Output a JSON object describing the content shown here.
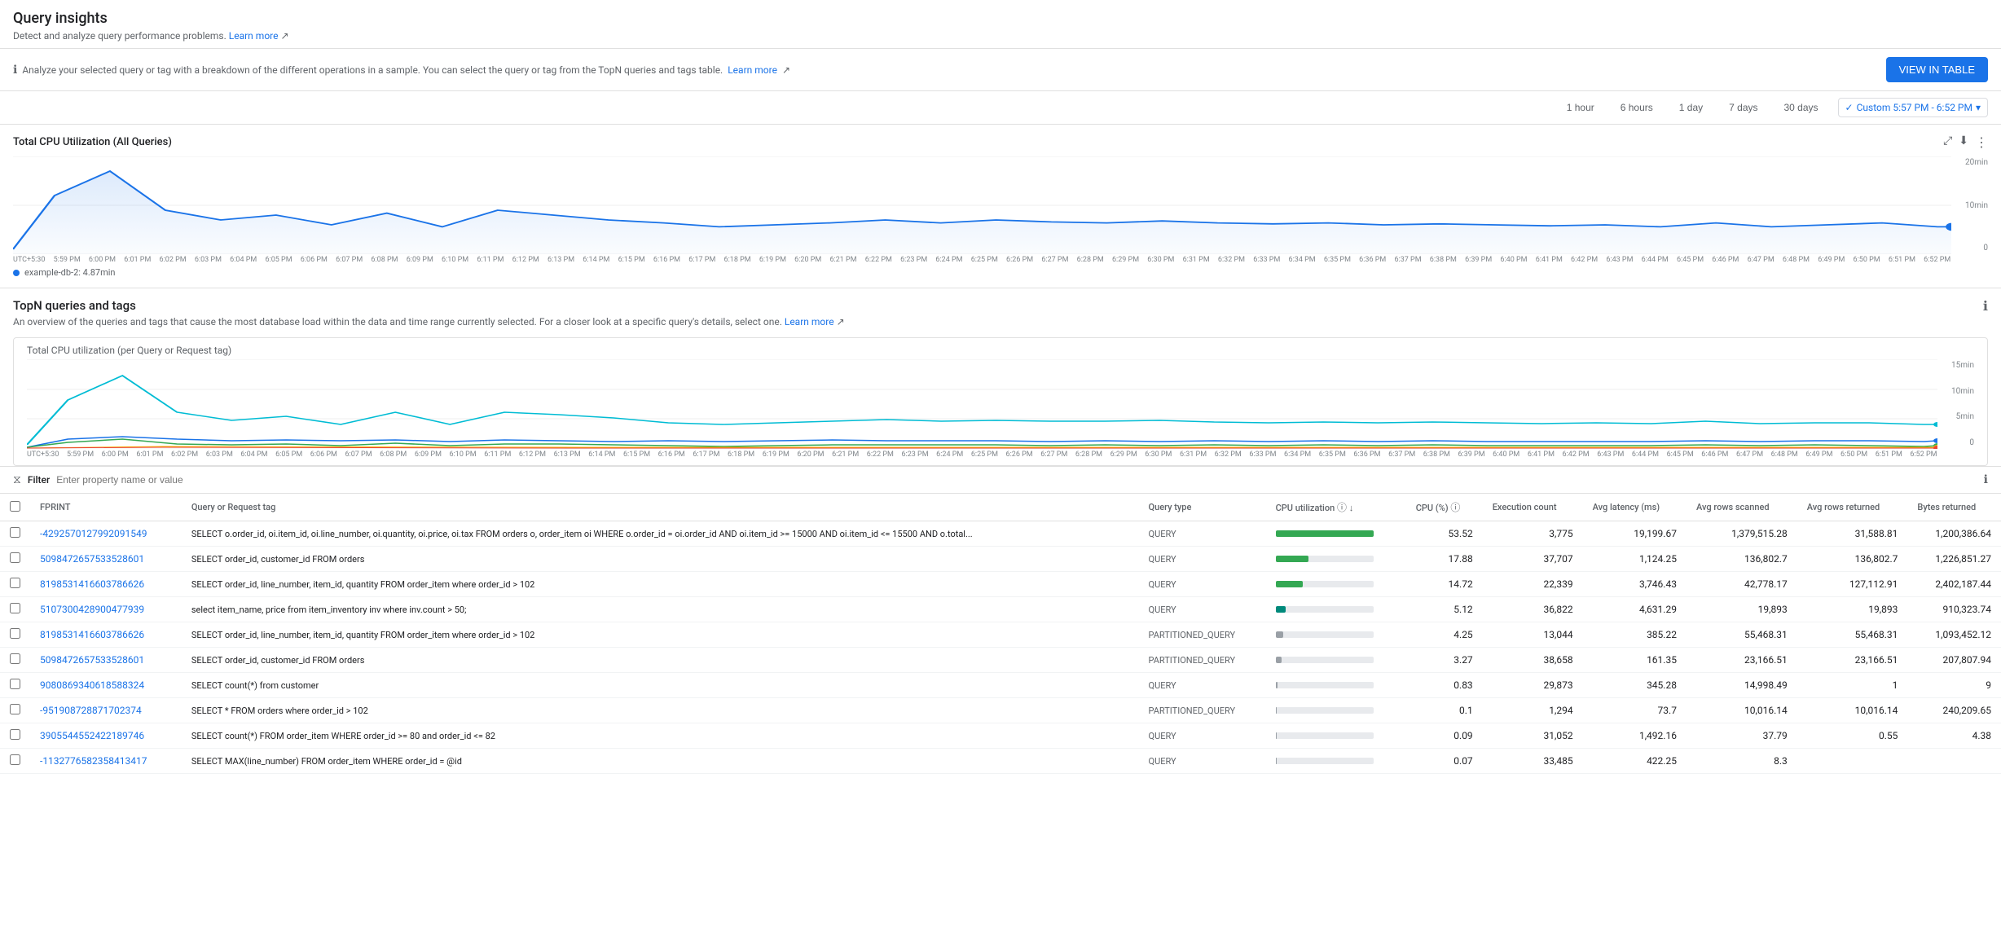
{
  "page": {
    "title": "Query insights",
    "subtitle": "Detect and analyze query performance problems.",
    "subtitle_link": "Learn more",
    "info_banner": "Analyze your selected query or tag with a breakdown of the different operations in a sample. You can select the query or tag from the TopN queries and tags table.",
    "info_banner_link": "Learn more",
    "view_table_btn": "VIEW IN TABLE"
  },
  "time_range": {
    "options": [
      "1 hour",
      "6 hours",
      "1 day",
      "7 days",
      "30 days"
    ],
    "custom_label": "Custom 5:57 PM - 6:52 PM",
    "active": "custom"
  },
  "total_cpu_chart": {
    "title": "Total CPU Utilization (All Queries)",
    "y_labels": [
      "20min",
      "10min",
      "0"
    ],
    "legend": "example-db-2: 4.87min",
    "legend_color": "#1a73e8"
  },
  "topn": {
    "title": "TopN queries and tags",
    "description": "An overview of the queries and tags that cause the most database load within the data and time range currently selected. For a closer look at a specific query's details, select one.",
    "description_link": "Learn more",
    "cpu_chart_title": "Total CPU utilization (per Query or Request tag)",
    "cpu_y_labels": [
      "15min",
      "10min",
      "5min",
      "0"
    ]
  },
  "filter": {
    "label": "Filter",
    "placeholder": "Enter property name or value"
  },
  "table": {
    "columns": [
      {
        "id": "checkbox",
        "label": ""
      },
      {
        "id": "fprint",
        "label": "FPRINT"
      },
      {
        "id": "query_tag",
        "label": "Query or Request tag"
      },
      {
        "id": "query_type",
        "label": "Query type"
      },
      {
        "id": "cpu_util",
        "label": "CPU utilization"
      },
      {
        "id": "cpu_pct",
        "label": "CPU (%)"
      },
      {
        "id": "exec_count",
        "label": "Execution count"
      },
      {
        "id": "avg_latency",
        "label": "Avg latency (ms)"
      },
      {
        "id": "avg_rows_scanned",
        "label": "Avg rows scanned"
      },
      {
        "id": "avg_rows_returned",
        "label": "Avg rows returned"
      },
      {
        "id": "bytes_returned",
        "label": "Bytes returned"
      }
    ],
    "rows": [
      {
        "fprint": "-4292570127992091549",
        "query": "SELECT o.order_id, oi.item_id, oi.line_number, oi.quantity, oi.price, oi.tax FROM orders o, order_item oi WHERE o.order_id = oi.order_id AND oi.item_id >= 15000 AND oi.item_id <= 15500 AND o.total...",
        "query_type": "QUERY",
        "cpu_pct": 53.52,
        "cpu_bar_width": 100,
        "cpu_bar_color": "cpu-bar-green",
        "exec_count": "3,775",
        "avg_latency": "19,199.67",
        "avg_rows_scanned": "1,379,515.28",
        "avg_rows_returned": "31,588.81",
        "bytes_returned": "1,200,386.64"
      },
      {
        "fprint": "5098472657533528601",
        "query": "SELECT order_id, customer_id FROM orders",
        "query_type": "QUERY",
        "cpu_pct": 17.88,
        "cpu_bar_width": 34,
        "cpu_bar_color": "cpu-bar-green",
        "exec_count": "37,707",
        "avg_latency": "1,124.25",
        "avg_rows_scanned": "136,802.7",
        "avg_rows_returned": "136,802.7",
        "bytes_returned": "1,226,851.27"
      },
      {
        "fprint": "8198531416603786626",
        "query": "SELECT order_id, line_number, item_id, quantity FROM order_item where order_id > 102",
        "query_type": "QUERY",
        "cpu_pct": 14.72,
        "cpu_bar_width": 28,
        "cpu_bar_color": "cpu-bar-green",
        "exec_count": "22,339",
        "avg_latency": "3,746.43",
        "avg_rows_scanned": "42,778.17",
        "avg_rows_returned": "127,112.91",
        "bytes_returned": "2,402,187.44"
      },
      {
        "fprint": "5107300428900477939",
        "query": "select item_name, price from item_inventory inv where inv.count > 50;",
        "query_type": "QUERY",
        "cpu_pct": 5.12,
        "cpu_bar_width": 10,
        "cpu_bar_color": "cpu-bar-teal",
        "exec_count": "36,822",
        "avg_latency": "4,631.29",
        "avg_rows_scanned": "19,893",
        "avg_rows_returned": "19,893",
        "bytes_returned": "910,323.74"
      },
      {
        "fprint": "8198531416603786626",
        "query": "SELECT order_id, line_number, item_id, quantity FROM order_item where order_id > 102",
        "query_type": "PARTITIONED_QUERY",
        "cpu_pct": 4.25,
        "cpu_bar_width": 8,
        "cpu_bar_color": "cpu-bar-gray",
        "exec_count": "13,044",
        "avg_latency": "385.22",
        "avg_rows_scanned": "55,468.31",
        "avg_rows_returned": "55,468.31",
        "bytes_returned": "1,093,452.12"
      },
      {
        "fprint": "5098472657533528601",
        "query": "SELECT order_id, customer_id FROM orders",
        "query_type": "PARTITIONED_QUERY",
        "cpu_pct": 3.27,
        "cpu_bar_width": 6,
        "cpu_bar_color": "cpu-bar-gray",
        "exec_count": "38,658",
        "avg_latency": "161.35",
        "avg_rows_scanned": "23,166.51",
        "avg_rows_returned": "23,166.51",
        "bytes_returned": "207,807.94"
      },
      {
        "fprint": "9080869340618588324",
        "query": "SELECT count(*) from customer",
        "query_type": "QUERY",
        "cpu_pct": 0.83,
        "cpu_bar_width": 2,
        "cpu_bar_color": "cpu-bar-gray",
        "exec_count": "29,873",
        "avg_latency": "345.28",
        "avg_rows_scanned": "14,998.49",
        "avg_rows_returned": "1",
        "bytes_returned": "9"
      },
      {
        "fprint": "-951908728871702374",
        "query": "SELECT * FROM orders where order_id > 102",
        "query_type": "PARTITIONED_QUERY",
        "cpu_pct": 0.1,
        "cpu_bar_width": 1,
        "cpu_bar_color": "cpu-bar-gray",
        "exec_count": "1,294",
        "avg_latency": "73.7",
        "avg_rows_scanned": "10,016.14",
        "avg_rows_returned": "10,016.14",
        "bytes_returned": "240,209.65"
      },
      {
        "fprint": "3905544552422189746",
        "query": "SELECT count(*) FROM order_item WHERE order_id >= 80 and order_id <= 82",
        "query_type": "QUERY",
        "cpu_pct": 0.09,
        "cpu_bar_width": 1,
        "cpu_bar_color": "cpu-bar-gray",
        "exec_count": "31,052",
        "avg_latency": "1,492.16",
        "avg_rows_scanned": "37.79",
        "avg_rows_returned": "0.55",
        "bytes_returned": "4.38"
      },
      {
        "fprint": "-1132776582358413417",
        "query": "SELECT MAX(line_number) FROM order_item WHERE order_id = @id",
        "query_type": "QUERY",
        "cpu_pct": 0.07,
        "cpu_bar_width": 1,
        "cpu_bar_color": "cpu-bar-gray",
        "exec_count": "33,485",
        "avg_latency": "422.25",
        "avg_rows_scanned": "8.3",
        "avg_rows_returned": "",
        "bytes_returned": ""
      }
    ]
  },
  "x_axis_labels_main": [
    "UTC+5:30",
    "5:59 PM",
    "6:00 PM",
    "6:01 PM",
    "6:02 PM",
    "6:03 PM",
    "6:04 PM",
    "6:05 PM",
    "6:06 PM",
    "6:07 PM",
    "6:08 PM",
    "6:09 PM",
    "6:10 PM",
    "6:11 PM",
    "6:12 PM",
    "6:13 PM",
    "6:14 PM",
    "6:15 PM",
    "6:16 PM",
    "6:17 PM",
    "6:18 PM",
    "6:19 PM",
    "6:20 PM",
    "6:21 PM",
    "6:22 PM",
    "6:23 PM",
    "6:24 PM",
    "6:25 PM",
    "6:26 PM",
    "6:27 PM",
    "6:28 PM",
    "6:29 PM",
    "6:30 PM",
    "6:31 PM",
    "6:32 PM",
    "6:33 PM",
    "6:34 PM",
    "6:35 PM",
    "6:36 PM",
    "6:37 PM",
    "6:38 PM",
    "6:39 PM",
    "6:40 PM",
    "6:41 PM",
    "6:42 PM",
    "6:43 PM",
    "6:44 PM",
    "6:45 PM",
    "6:46 PM",
    "6:47 PM",
    "6:48 PM",
    "6:49 PM",
    "6:50 PM",
    "6:51 PM",
    "6:52 PM"
  ]
}
